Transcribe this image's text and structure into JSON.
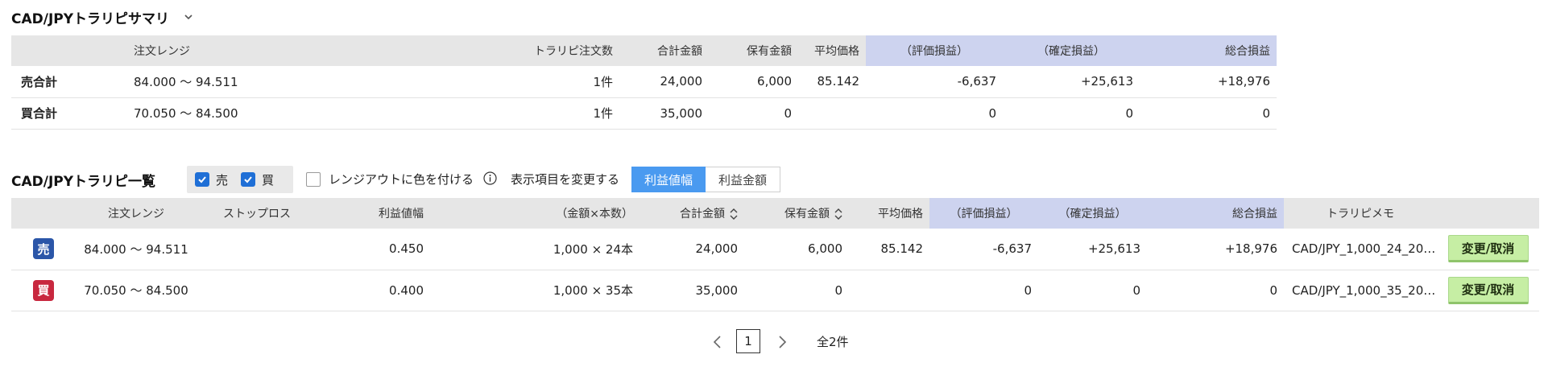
{
  "summary": {
    "title": "CAD/JPYトラリピサマリ",
    "headers": {
      "range": "注文レンジ",
      "count": "トラリピ注文数",
      "total_amount": "合計金額",
      "held_amount": "保有金額",
      "avg_price": "平均価格",
      "unrealized": "（評価損益）",
      "realized": "（確定損益）",
      "total_pl": "総合損益"
    },
    "rows": [
      {
        "label": "売合計",
        "range": "84.000 〜 94.511",
        "count": "1件",
        "total_amount": "24,000",
        "held_amount": "6,000",
        "avg_price": "85.142",
        "unrealized": "-6,637",
        "realized": "+25,613",
        "total_pl": "+18,976"
      },
      {
        "label": "買合計",
        "range": "70.050 〜 84.500",
        "count": "1件",
        "total_amount": "35,000",
        "held_amount": "0",
        "avg_price": "",
        "unrealized": "0",
        "realized": "0",
        "total_pl": "0"
      }
    ]
  },
  "list": {
    "title": "CAD/JPYトラリピ一覧",
    "filter_sell": "売",
    "filter_buy": "買",
    "range_color_label": "レンジアウトに色を付ける",
    "display_label": "表示項目を変更する",
    "toggle_profit_width": "利益値幅",
    "toggle_profit_amount": "利益金額",
    "headers": {
      "range": "注文レンジ",
      "stop_loss": "ストップロス",
      "profit_width": "利益値幅",
      "qty": "（金額×本数）",
      "total_amount": "合計金額",
      "held_amount": "保有金額",
      "avg_price": "平均価格",
      "unrealized": "（評価損益）",
      "realized": "（確定損益）",
      "total_pl": "総合損益",
      "memo": "トラリピメモ"
    },
    "rows": [
      {
        "badge": "売",
        "range": "84.000 〜 94.511",
        "stop_loss": "",
        "profit_width": "0.450",
        "qty": "1,000 × 24本",
        "total_amount": "24,000",
        "held_amount": "6,000",
        "avg_price": "85.142",
        "unrealized": "-6,637",
        "realized": "+25,613",
        "total_pl": "+18,976",
        "memo": "CAD/JPY_1,000_24_20…",
        "action": "変更/取消"
      },
      {
        "badge": "買",
        "range": "70.050 〜 84.500",
        "stop_loss": "",
        "profit_width": "0.400",
        "qty": "1,000 × 35本",
        "total_amount": "35,000",
        "held_amount": "0",
        "avg_price": "",
        "unrealized": "0",
        "realized": "0",
        "total_pl": "0",
        "memo": "CAD/JPY_1,000_35_20…",
        "action": "変更/取消"
      }
    ]
  },
  "pagination": {
    "current": "1",
    "total": "全2件"
  },
  "colors": {
    "sell": "#2b56a8",
    "buy": "#c8283f",
    "negative": "#d0364a",
    "header_bg": "#e6e6e6",
    "pl_header_bg": "#cdd3ef",
    "toggle_active": "#4a9af0",
    "action_button": "#c6eea4"
  },
  "icons": {
    "dropdown": "chevron-down-icon",
    "checkbox": "check-icon",
    "info": "info-icon",
    "sort": "sort-icon",
    "prev": "chevron-left-icon",
    "next": "chevron-right-icon"
  }
}
